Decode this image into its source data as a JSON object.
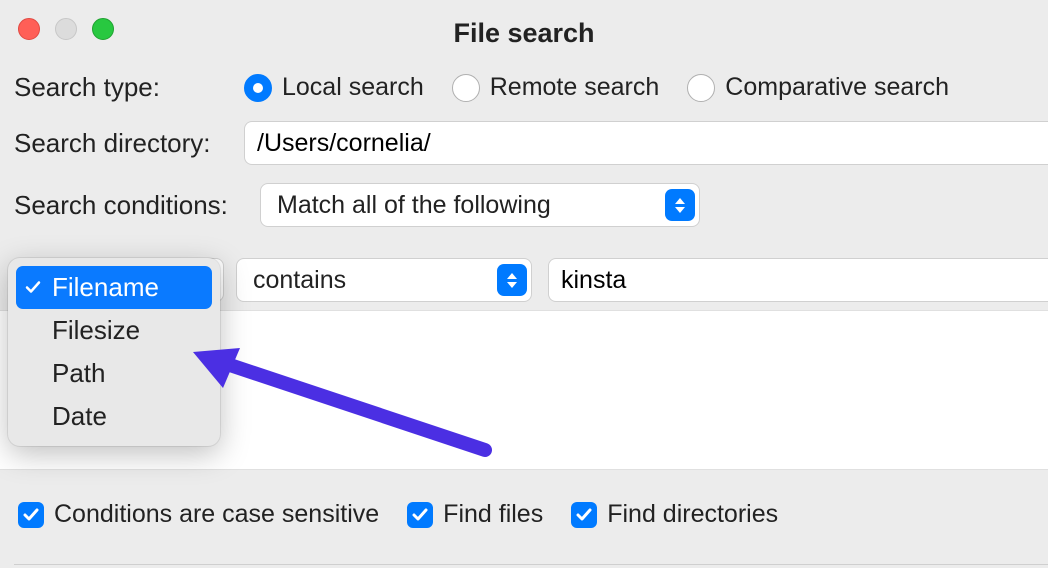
{
  "window": {
    "title": "File search"
  },
  "labels": {
    "searchType": "Search type:",
    "searchDirectory": "Search directory:",
    "searchConditions": "Search conditions:"
  },
  "searchType": {
    "options": {
      "local": "Local search",
      "remote": "Remote search",
      "comparative": "Comparative search"
    },
    "selected": "local"
  },
  "searchDirectory": {
    "value": "/Users/cornelia/"
  },
  "conditionsMatch": {
    "label": "Match all of the following"
  },
  "conditionRow": {
    "fieldDropdown": {
      "options": [
        "Filename",
        "Filesize",
        "Path",
        "Date"
      ],
      "selected": "Filename"
    },
    "operator": "contains",
    "value": "kinsta"
  },
  "bottom": {
    "caseSensitive": "Conditions are case sensitive",
    "findFiles": "Find files",
    "findDirectories": "Find directories"
  }
}
